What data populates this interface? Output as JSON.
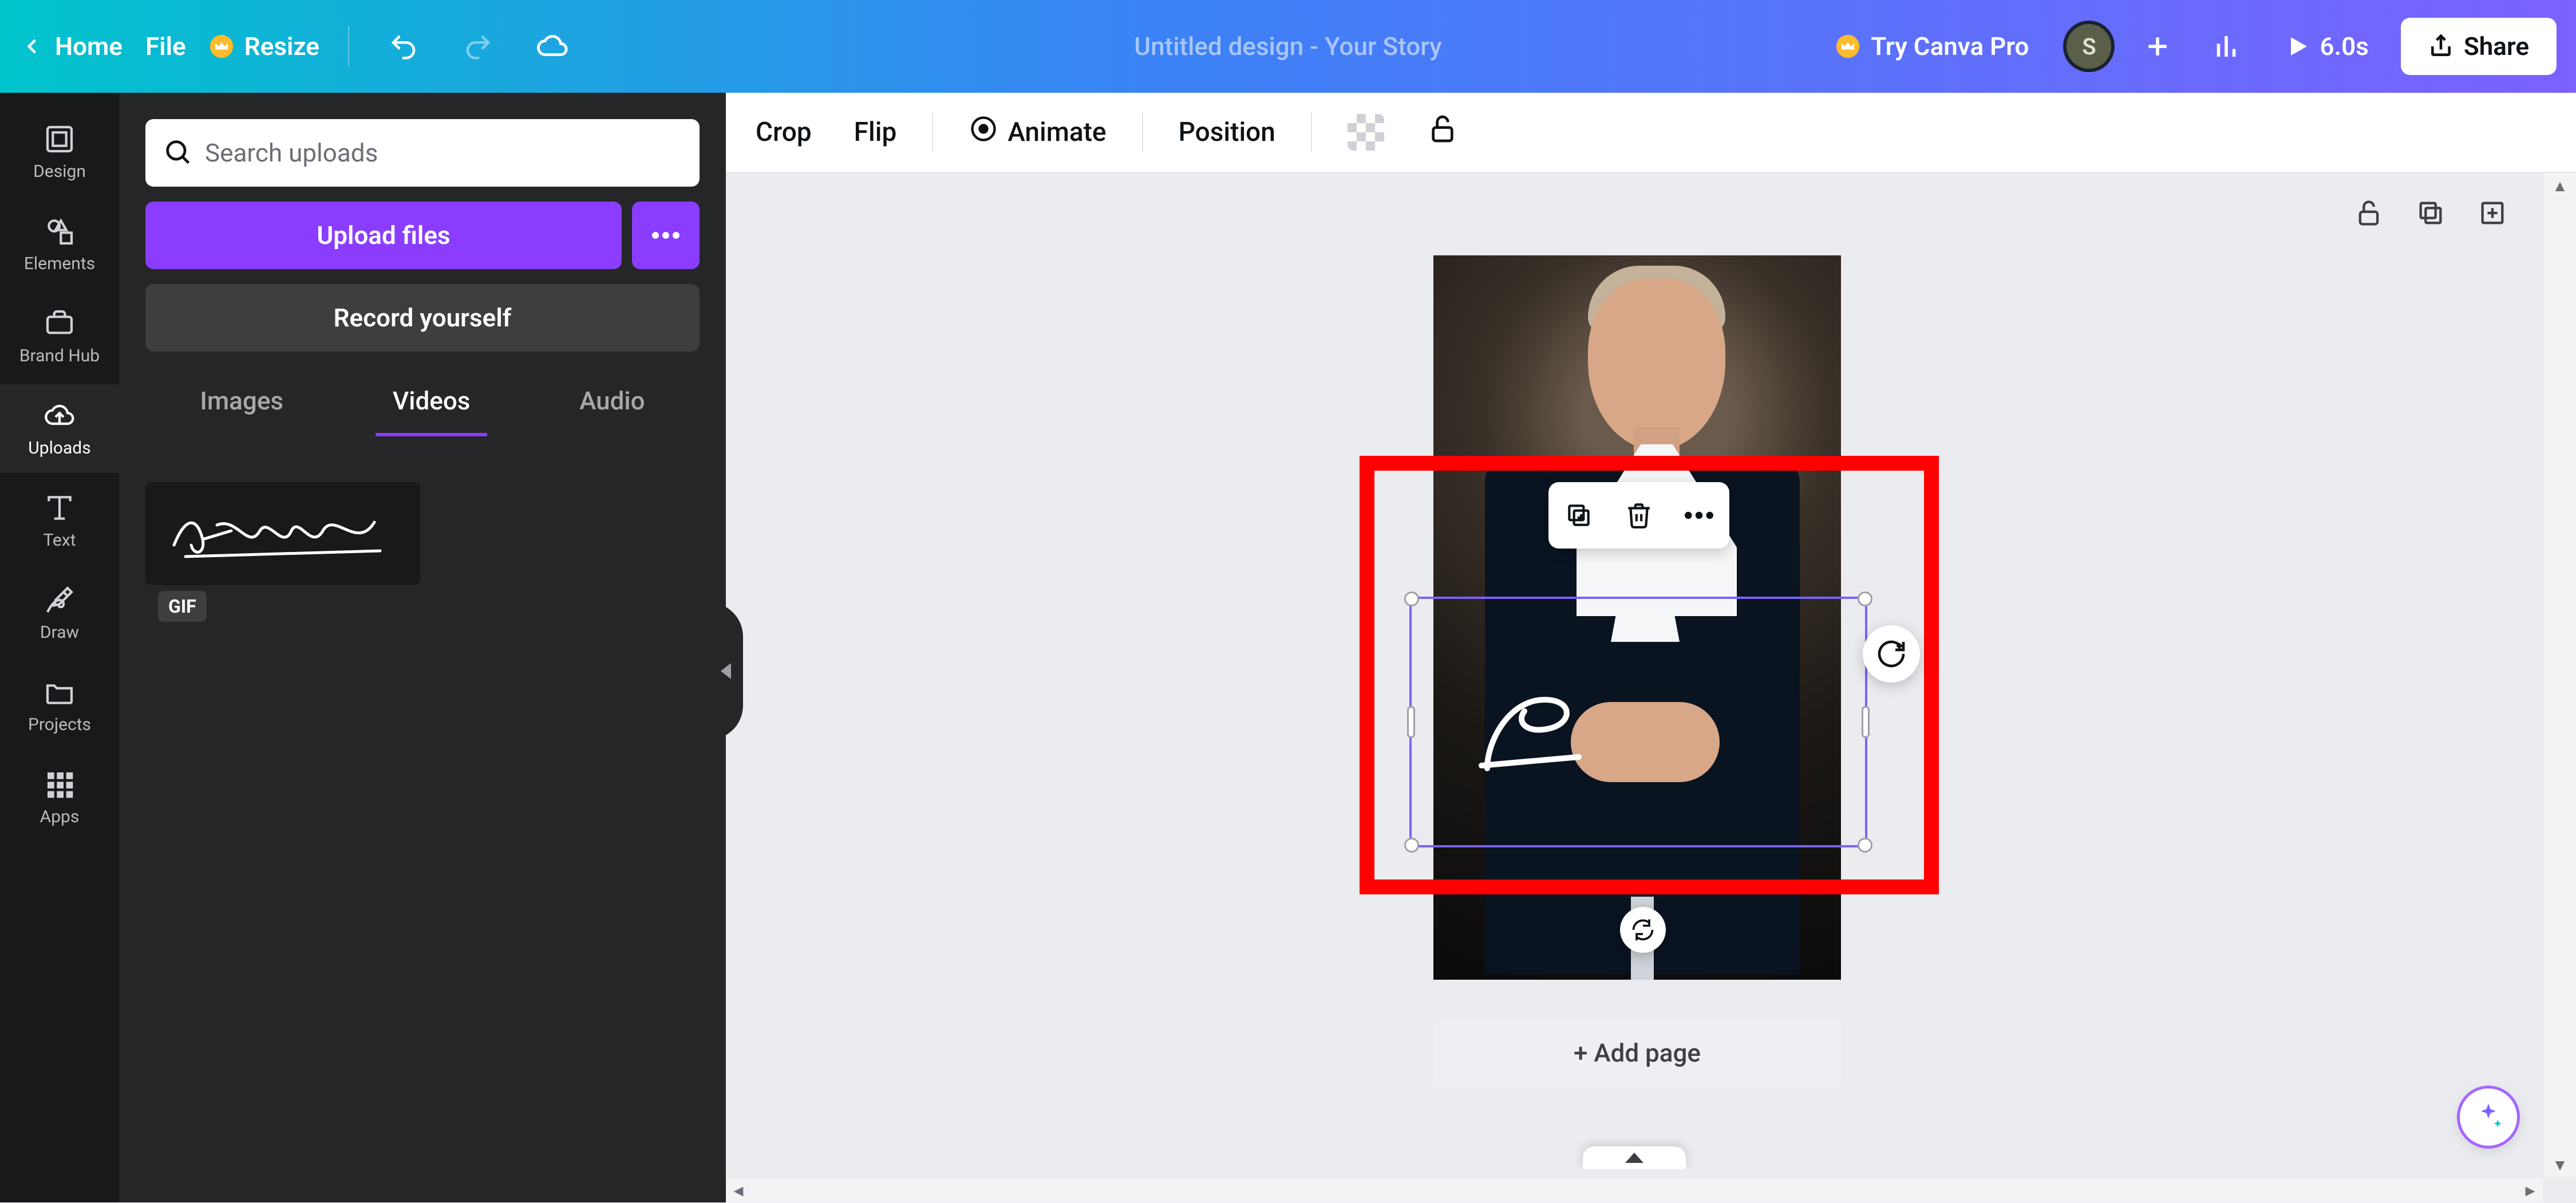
{
  "topbar": {
    "home": "Home",
    "file": "File",
    "resize": "Resize",
    "title": "Untitled design - Your Story",
    "try_pro": "Try Canva Pro",
    "avatar_initial": "S",
    "duration": "6.0s",
    "share": "Share"
  },
  "rail": {
    "items": [
      {
        "key": "design",
        "label": "Design"
      },
      {
        "key": "elements",
        "label": "Elements"
      },
      {
        "key": "brandhub",
        "label": "Brand Hub"
      },
      {
        "key": "uploads",
        "label": "Uploads"
      },
      {
        "key": "text",
        "label": "Text"
      },
      {
        "key": "draw",
        "label": "Draw"
      },
      {
        "key": "projects",
        "label": "Projects"
      },
      {
        "key": "apps",
        "label": "Apps"
      }
    ],
    "active": "uploads"
  },
  "panel": {
    "search_placeholder": "Search uploads",
    "upload": "Upload files",
    "record": "Record yourself",
    "tabs": {
      "images": "Images",
      "videos": "Videos",
      "audio": "Audio",
      "active": "videos"
    },
    "thumb_signature_text": "David Schmidt",
    "gif_badge": "GIF"
  },
  "context": {
    "crop": "Crop",
    "flip": "Flip",
    "animate": "Animate",
    "position": "Position"
  },
  "canvas": {
    "add_page": "+ Add page",
    "signature_fragment_text": "D"
  },
  "colors": {
    "accent_purple": "#8b3dff",
    "selection_purple": "#7b61ff",
    "highlight_red": "#ff0000"
  }
}
